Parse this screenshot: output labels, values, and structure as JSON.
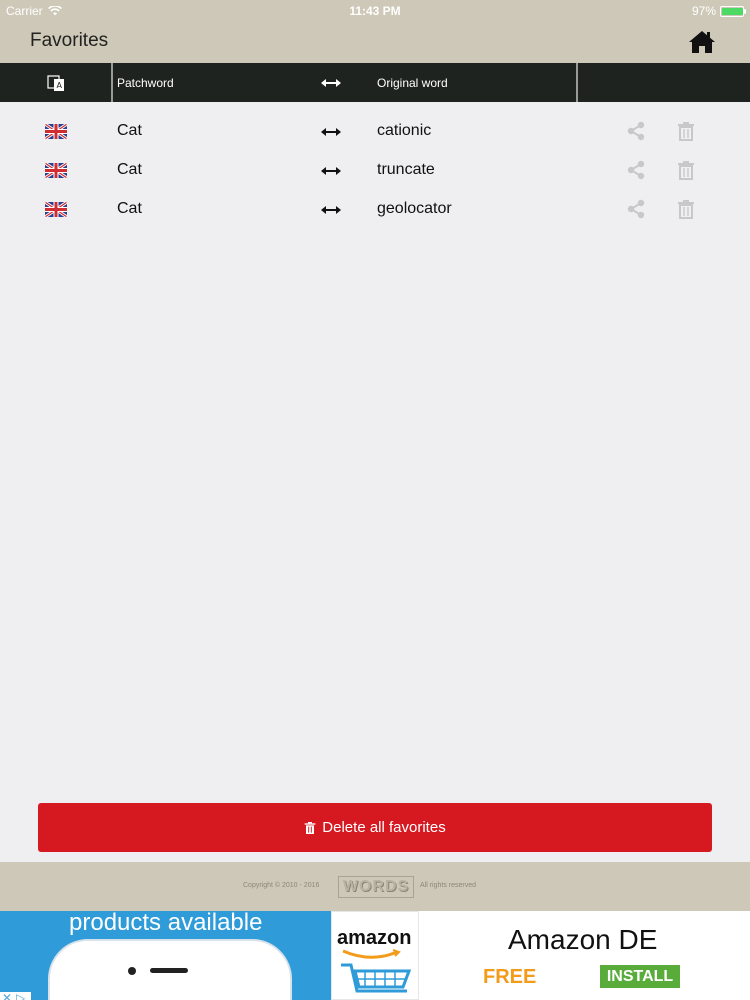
{
  "status_bar": {
    "carrier": "Carrier",
    "time": "11:43 PM",
    "battery": "97%",
    "battery_level": 0.97
  },
  "title_bar": {
    "title": "Favorites",
    "home_icon": "home-icon"
  },
  "table_header": {
    "patchword": "Patchword",
    "original": "Original word",
    "language_icon": "translate-icon",
    "arrow_icon": "double-arrow-icon"
  },
  "favorites": [
    {
      "flag": "uk-flag-icon",
      "patchword": "Cat",
      "original": "cationic"
    },
    {
      "flag": "uk-flag-icon",
      "patchword": "Cat",
      "original": "truncate"
    },
    {
      "flag": "uk-flag-icon",
      "patchword": "Cat",
      "original": "geolocator"
    }
  ],
  "row_actions": {
    "share_icon": "share-icon",
    "delete_icon": "trash-icon"
  },
  "delete_all": {
    "label": "Delete all favorites",
    "icon": "trash-icon",
    "color": "#d61920"
  },
  "footer": {
    "copyright": "Copyright © 2010 - 2016",
    "logo": "WORDS",
    "rights": "All rights reserved"
  },
  "ad": {
    "headline": "products available",
    "brand": "amazon",
    "title": "Amazon DE",
    "free": "FREE",
    "install": "INSTALL"
  },
  "colors": {
    "header_bg": "#1f2320",
    "bar_bg": "#cdc8b7",
    "list_bg": "#efeff1"
  }
}
